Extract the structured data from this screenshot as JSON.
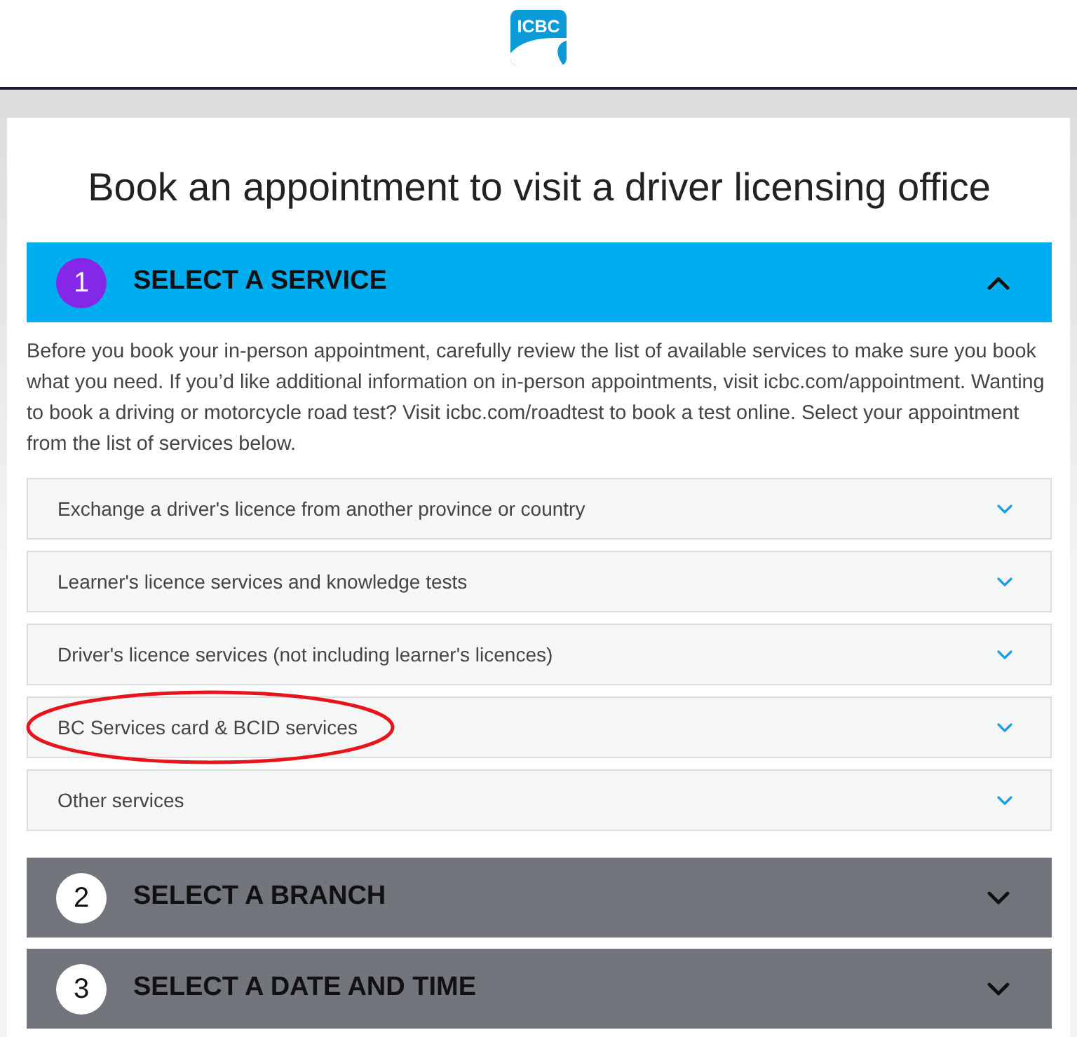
{
  "header": {
    "logo_text": "ICBC"
  },
  "title": "Book an appointment to visit a driver licensing office",
  "steps": [
    {
      "number": "1",
      "label": "SELECT A SERVICE",
      "expanded": true,
      "intro": "Before you book your in-person appointment, carefully review the list of available services to make sure you book what you need. If you’d like additional information on in-person appointments, visit icbc.com/appointment. Wanting to book a driving or motorcycle road test? Visit icbc.com/roadtest to book a test online. Select your appointment from the list of services below.",
      "services": [
        {
          "label": "Exchange a driver's licence from another province or country",
          "expanded": false,
          "highlighted": false
        },
        {
          "label": "Learner's licence services and knowledge tests",
          "expanded": false,
          "highlighted": false
        },
        {
          "label": "Driver's licence services (not including learner's licences)",
          "expanded": false,
          "highlighted": false
        },
        {
          "label": "BC Services card & BCID services",
          "expanded": false,
          "highlighted": true
        },
        {
          "label": "Other services",
          "expanded": false,
          "highlighted": false
        }
      ]
    },
    {
      "number": "2",
      "label": "SELECT A BRANCH",
      "expanded": false
    },
    {
      "number": "3",
      "label": "SELECT A DATE AND TIME",
      "expanded": false
    }
  ]
}
